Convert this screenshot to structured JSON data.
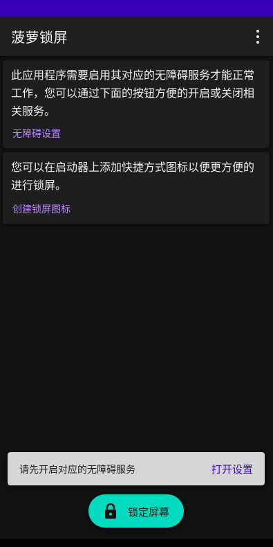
{
  "app": {
    "title": "菠萝锁屏",
    "menu_icon": "more-vert-icon"
  },
  "cards": [
    {
      "body": "此应用程序需要启用其对应的无障碍服务才能正常工作，您可以通过下面的按钮方便的开启或关闭相关服务。",
      "link": "无障碍设置"
    },
    {
      "body": "您可以在启动器上添加快捷方式图标以便更方便的进行锁屏。",
      "link": "创建锁屏图标"
    }
  ],
  "snackbar": {
    "message": "请先开启对应的无障碍服务",
    "action": "打开设置"
  },
  "fab": {
    "label": "锁定屏幕",
    "icon": "lock-icon"
  },
  "colors": {
    "status_bar": "#3a00b8",
    "accent": "#bb86fc",
    "fab": "#00dbc0",
    "snackbar_action": "#3f00c8"
  }
}
